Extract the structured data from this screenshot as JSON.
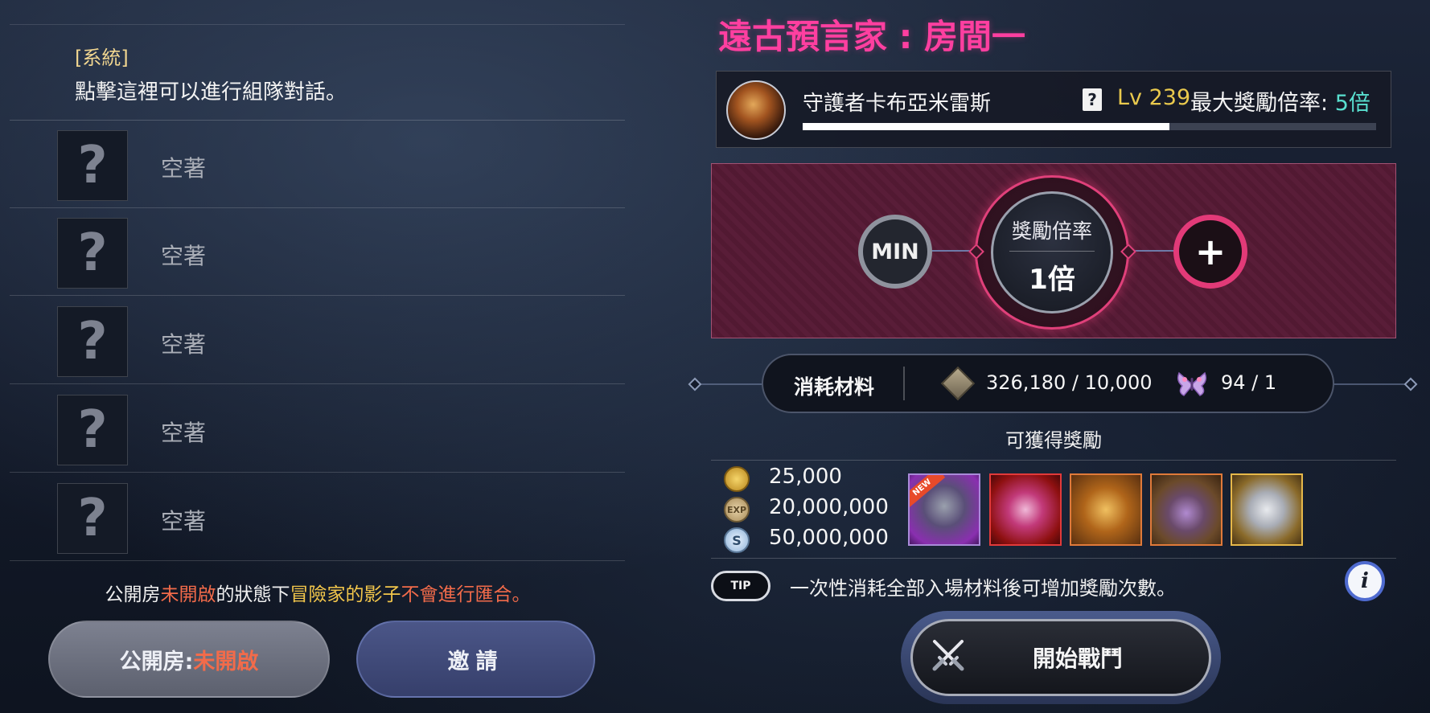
{
  "chat": {
    "system_tag": "[系統]",
    "hint": "點擊這裡可以進行組隊對話。"
  },
  "party_slots": [
    {
      "avatar": "?",
      "label": "空著"
    },
    {
      "avatar": "?",
      "label": "空著"
    },
    {
      "avatar": "?",
      "label": "空著"
    },
    {
      "avatar": "?",
      "label": "空著"
    },
    {
      "avatar": "?",
      "label": "空著"
    }
  ],
  "notice": {
    "part1": "公開房",
    "part2": "未開啟",
    "part3": "的狀態下",
    "part4": "冒險家的影子",
    "part5": "不會進行匯合。"
  },
  "buttons": {
    "public_room_prefix": "公開房:",
    "public_room_state": "未開啟",
    "invite": "邀請",
    "start_battle": "開始戰鬥"
  },
  "room": {
    "title": "遠古預言家 : 房間一"
  },
  "boss": {
    "name": "守護者卡布亞米雷斯",
    "help_glyph": "?",
    "level": "Lv 239",
    "max_reward_label": "最大獎勵倍率:",
    "max_reward_value": "5倍",
    "hp_fraction": 0.64
  },
  "multiplier": {
    "min_label": "MIN",
    "label": "獎勵倍率",
    "value": "1倍",
    "plus_label": "+"
  },
  "cost": {
    "label": "消耗材料",
    "stone_amount": "326,180 / 10,000",
    "moth_amount": "94 / 1"
  },
  "rewards": {
    "title": "可獲得獎勵",
    "gold": "25,000",
    "exp": "20,000,000",
    "silver": "50,000,000",
    "exp_icon_text": "EXP",
    "silver_icon_text": "S",
    "new_badge": "NEW"
  },
  "tip": {
    "badge": "TIP",
    "text": "一次性消耗全部入場材料後可增加獎勵次數。",
    "info_glyph": "i"
  },
  "colors": {
    "title_pink": "#ff3fa0",
    "level_gold": "#e9c94d",
    "reward_teal": "#59e0d0",
    "warning_red": "#f26b4a",
    "warning_gold": "#f2c64b",
    "multiplier_ring": "#e23a78"
  }
}
